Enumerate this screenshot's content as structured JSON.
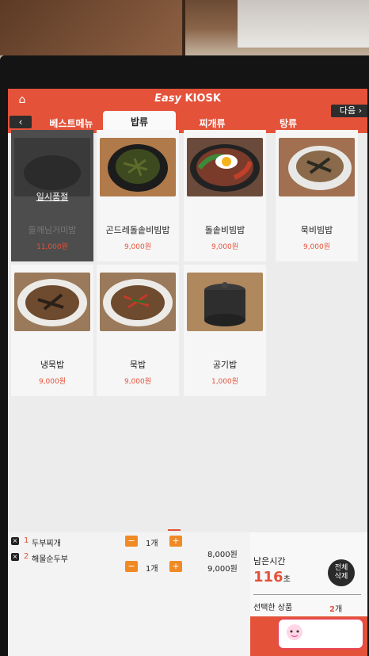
{
  "header": {
    "brand_prefix": "Easy",
    "brand_suffix": "KIOSK"
  },
  "nav": {
    "prev_label": "‹",
    "next_label": "다음 ›",
    "tabs": [
      {
        "label": "베스트메뉴",
        "active": false
      },
      {
        "label": "밥류",
        "active": true
      },
      {
        "label": "찌개류",
        "active": false
      },
      {
        "label": "탕류",
        "active": false
      }
    ]
  },
  "menu": {
    "soldout_label": "일시품절",
    "items": [
      {
        "name": "들깨님거미밥",
        "price": "11,000원",
        "soldout": true
      },
      {
        "name": "곤드레돌솥비빔밥",
        "price": "9,000원",
        "soldout": false
      },
      {
        "name": "돌솥비빔밥",
        "price": "9,000원",
        "soldout": false
      },
      {
        "name": "묵비빔밥",
        "price": "9,000원",
        "soldout": false
      },
      {
        "name": "냉묵밥",
        "price": "9,000원",
        "soldout": false
      },
      {
        "name": "묵밥",
        "price": "9,000원",
        "soldout": false
      },
      {
        "name": "공기밥",
        "price": "1,000원",
        "soldout": false
      }
    ]
  },
  "cart": {
    "rows": [
      {
        "num": "1",
        "name": "두부찌개",
        "qty": "1개",
        "price": "8,000원"
      },
      {
        "num": "2",
        "name": "해물순두부",
        "qty": "1개",
        "price": "9,000원"
      }
    ],
    "minus": "−",
    "plus": "+",
    "remove": "×",
    "time_label": "남은시간",
    "time_value": "116",
    "time_unit": "초",
    "clear_line1": "전체",
    "clear_line2": "삭제",
    "selected_label": "선택한 상품",
    "selected_count": "2",
    "selected_unit": "개"
  }
}
